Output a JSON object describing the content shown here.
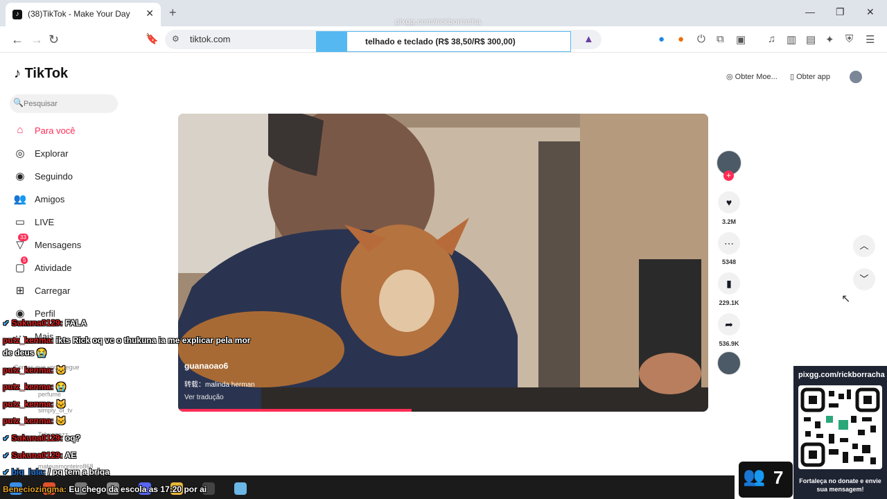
{
  "browser": {
    "tab_title": "(38)TikTok - Make Your Day",
    "url": "tiktok.com",
    "overlay_watermark": "pixgg.com/rickborracha",
    "donate_banner": "telhado e teclado (R$ 38,50/R$ 300,00)"
  },
  "tiktok": {
    "logo": "TikTok",
    "search_placeholder": "Pesquisar",
    "nav": [
      {
        "label": "Para você",
        "icon": "home-icon",
        "active": true
      },
      {
        "label": "Explorar",
        "icon": "compass-icon"
      },
      {
        "label": "Seguindo",
        "icon": "following-avatar-icon"
      },
      {
        "label": "Amigos",
        "icon": "friends-icon"
      },
      {
        "label": "LIVE",
        "icon": "live-icon"
      },
      {
        "label": "Mensagens",
        "icon": "messages-icon",
        "badge": "33"
      },
      {
        "label": "Atividade",
        "icon": "activity-icon",
        "badge": "5"
      },
      {
        "label": "Carregar",
        "icon": "upload-icon"
      },
      {
        "label": "Perfil",
        "icon": "profile-avatar-icon"
      },
      {
        "label": "Mais",
        "icon": "more-icon"
      }
    ],
    "header": {
      "coins": "Obter Moe...",
      "app": "Obter app"
    },
    "video": {
      "author": "guanaoao6",
      "repost": "转载：malinda herman",
      "translate": "Ver tradução",
      "progress": 0.44
    },
    "actions": {
      "likes": "3.2M",
      "comments": "5348",
      "saves": "229.1K",
      "shares": "536.9K"
    },
    "following_faded": [
      "Contas que você segue",
      "perfume",
      "simply_ol_tv",
      "Tchuggazz",
      "mateusmonteiro868"
    ]
  },
  "stream": {
    "chat": [
      {
        "user": "Sukuna0129:",
        "msg": "FALA",
        "check": true
      },
      {
        "user": "putz_kenma:",
        "msg": "ikts Rick oq vc o thukuna ia me explicar pela mor",
        "check": false
      },
      {
        "user": "",
        "msg": "de deus 😭",
        "check": false
      },
      {
        "user": "putz_kenma:",
        "msg": "🐱",
        "check": false
      },
      {
        "user": "putz_kenma:",
        "msg": "😭",
        "check": false
      },
      {
        "user": "putz_kenma:",
        "msg": "🐱",
        "check": false
      },
      {
        "user": "putz_kenma:",
        "msg": "🐱",
        "check": false
      },
      {
        "user": "Sukuna0129:",
        "msg": "oq?",
        "check": true
      },
      {
        "user": "Sukuna0129:",
        "msg": "AE",
        "check": true
      },
      {
        "user": "big_lula:",
        "msg": "/ pq tem a briga",
        "check": true
      },
      {
        "user": "Beneciozingma:",
        "msg": "Eu chego da escola as 17:20 por ai",
        "check": false
      }
    ],
    "qr_title": "pixgg.com/rickborracha",
    "qr_footer": "Fortaleça no donate e envie sua mensagem!",
    "viewers": "7"
  }
}
